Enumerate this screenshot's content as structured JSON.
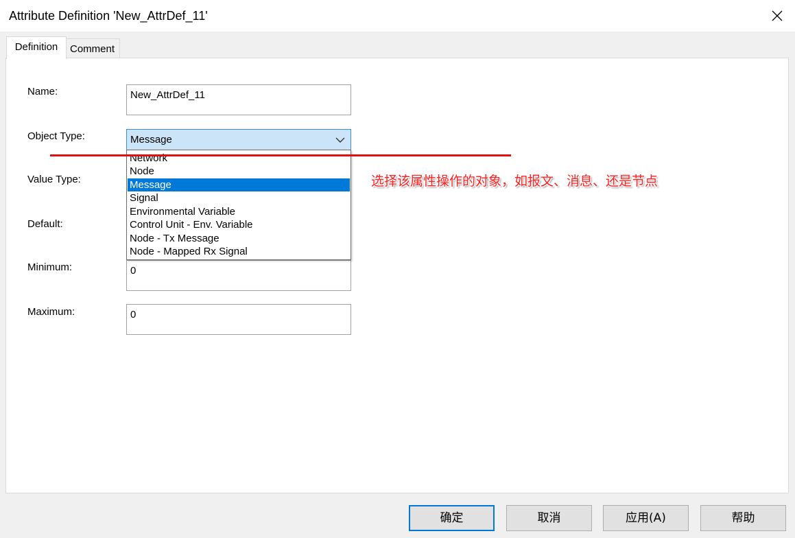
{
  "window": {
    "title": "Attribute Definition 'New_AttrDef_11'"
  },
  "tabs": [
    {
      "label": "Definition"
    },
    {
      "label": "Comment"
    }
  ],
  "form": {
    "name": {
      "label": "Name:",
      "value": "New_AttrDef_11"
    },
    "object_type": {
      "label": "Object Type:",
      "value": "Message",
      "options": [
        "Network",
        "Node",
        "Message",
        "Signal",
        "Environmental Variable",
        "Control Unit - Env. Variable",
        "Node - Tx Message",
        "Node - Mapped Rx Signal"
      ]
    },
    "value_type": {
      "label": "Value Type:"
    },
    "default": {
      "label": "Default:"
    },
    "minimum": {
      "label": "Minimum:",
      "value": "0"
    },
    "maximum": {
      "label": "Maximum:",
      "value": "0"
    }
  },
  "annotation": {
    "text": "选择该属性操作的对象，如报文、消息、还是节点",
    "color": "#ff2020"
  },
  "buttons": {
    "ok": "确定",
    "cancel": "取消",
    "apply": "应用(A)",
    "help": "帮助"
  },
  "colors": {
    "selection": "#0078d7",
    "combo_focus": "#cce4f7",
    "annotation_line": "#e01010"
  }
}
